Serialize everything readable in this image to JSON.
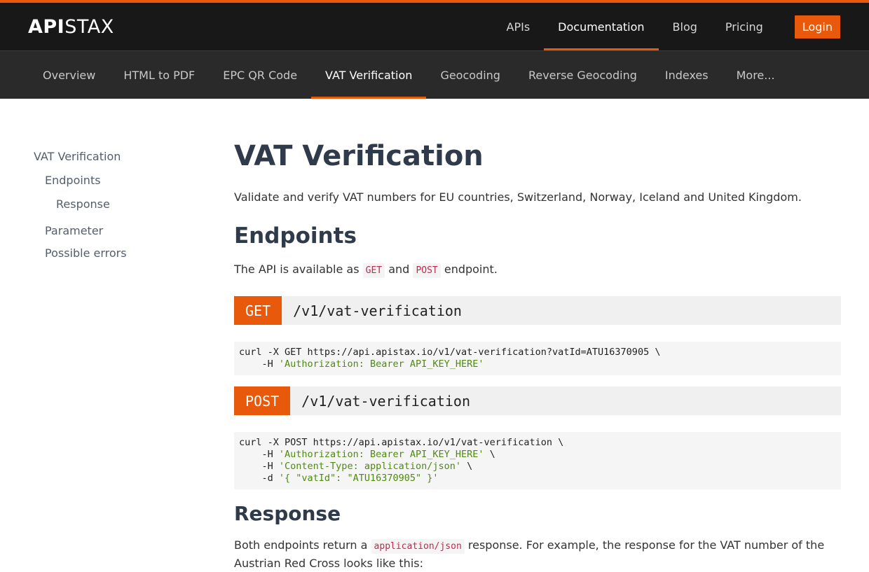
{
  "brand": {
    "part1": "API",
    "part2": "STAX"
  },
  "topnav": {
    "items": [
      "APIs",
      "Documentation",
      "Blog",
      "Pricing"
    ],
    "login": "Login"
  },
  "subnav": {
    "items": [
      "Overview",
      "HTML to PDF",
      "EPC QR Code",
      "VAT Verification",
      "Geocoding",
      "Reverse Geocoding",
      "Indexes",
      "More..."
    ]
  },
  "toc": {
    "items": [
      "VAT Verification",
      "Endpoints",
      "Response",
      "Parameter",
      "Possible errors"
    ]
  },
  "content": {
    "title": "VAT Verification",
    "lead": "Validate and verify VAT numbers for EU countries, Switzerland, Norway, Iceland and United Kingdom.",
    "endpoints_heading": "Endpoints",
    "avail_text_1": "The API is available as",
    "avail_get": "GET",
    "avail_and": "and",
    "avail_post": "POST",
    "avail_text_2": "endpoint.",
    "get_method": "GET",
    "get_path": "/v1/vat-verification",
    "get_code_line1": "curl -X GET https://api.apistax.io/v1/vat-verification?vatId=ATU16370905 \\",
    "get_code_line2_prefix": "    -H ",
    "get_code_line2_str": "'Authorization: Bearer API_KEY_HERE'",
    "post_method": "POST",
    "post_path": "/v1/vat-verification",
    "post_code_line1": "curl -X POST https://api.apistax.io/v1/vat-verification \\",
    "post_code_line2_prefix": "    -H ",
    "post_code_line2_str": "'Authorization: Bearer API_KEY_HERE'",
    "post_code_line2_suffix": " \\",
    "post_code_line3_prefix": "    -H ",
    "post_code_line3_str": "'Content-Type: application/json'",
    "post_code_line3_suffix": " \\",
    "post_code_line4_prefix": "    -d ",
    "post_code_line4_str": "'{ \"vatId\": \"ATU16370905\" }'",
    "response_heading": "Response",
    "response_text_1": "Both endpoints return a",
    "response_code": "application/json",
    "response_text_2": "response. For example, the response for the VAT number of the Austrian Red Cross looks like this:"
  },
  "colors": {
    "accent": "#e8590c",
    "topbar": "#181818",
    "subbar": "#2a2a2a"
  }
}
